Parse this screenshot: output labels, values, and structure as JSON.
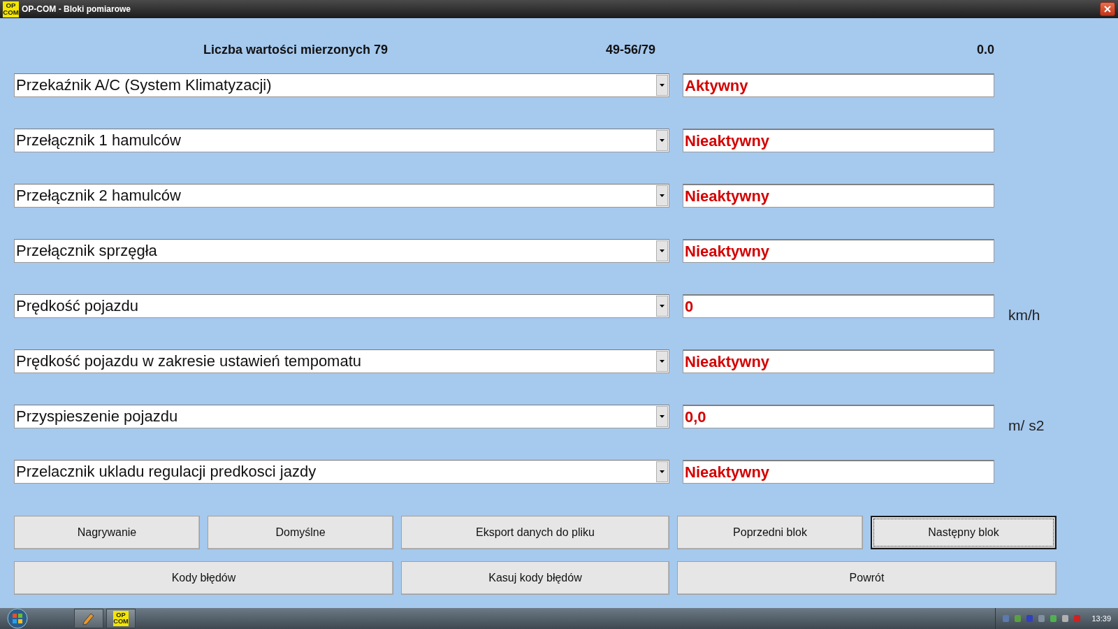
{
  "window": {
    "icon_text": "OP COM",
    "title": "OP-COM - Bloki pomiarowe"
  },
  "header": {
    "count_label": "Liczba wartości mierzonych 79",
    "range": "49-56/79",
    "time": "0.0"
  },
  "measurements": [
    {
      "name": "Przekaźnik A/C (System Klimatyzacji)",
      "value": "Aktywny"
    },
    {
      "name": "Przełącznik 1 hamulców",
      "value": "Nieaktywny"
    },
    {
      "name": "Przełącznik 2 hamulców",
      "value": "Nieaktywny"
    },
    {
      "name": "Przełącznik sprzęgła",
      "value": "Nieaktywny"
    },
    {
      "name": "Prędkość pojazdu",
      "value": "0",
      "unit": "km/h"
    },
    {
      "name": "Prędkość pojazdu w zakresie ustawień tempomatu",
      "value": "Nieaktywny"
    },
    {
      "name": "Przyspieszenie pojazdu",
      "value": "0,0",
      "unit": "m/ s2"
    },
    {
      "name": "Przelacznik ukladu regulacji predkosci jazdy",
      "value": "Nieaktywny"
    }
  ],
  "buttons_row_1": [
    {
      "label": "Nagrywanie",
      "focused": false
    },
    {
      "label": "Domyślne",
      "focused": false
    },
    {
      "label": "Eksport danych do pliku",
      "focused": false
    },
    {
      "label": "Poprzedni blok",
      "focused": false
    },
    {
      "label": "Następny blok",
      "focused": true
    }
  ],
  "buttons_row_2": [
    {
      "label": "Kody błędów",
      "focused": false
    },
    {
      "label": "Kasuj kody błędów",
      "focused": false
    },
    {
      "label": "Powrót",
      "focused": false
    }
  ],
  "taskbar": {
    "app_icon_text": "OP COM",
    "clock": "13:39"
  }
}
